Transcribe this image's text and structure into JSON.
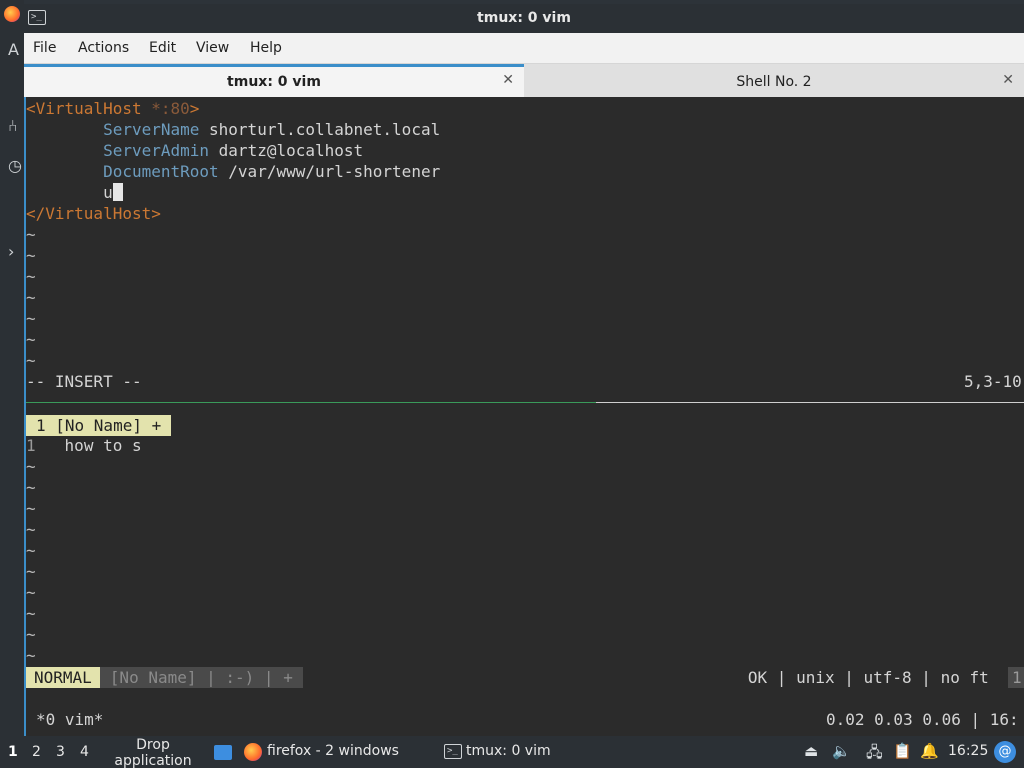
{
  "desktop": {
    "left_glyphs": [
      "A",
      "⑃",
      "◷",
      "›"
    ]
  },
  "window": {
    "title": "tmux: 0 vim",
    "menu": [
      "File",
      "Actions",
      "Edit",
      "View",
      "Help"
    ],
    "tabs": [
      {
        "label": "tmux: 0 vim",
        "active": true
      },
      {
        "label": "Shell No. 2",
        "active": false
      }
    ]
  },
  "vim_top": {
    "lines": [
      {
        "parts": [
          "<VirtualHost",
          " *:80",
          ">"
        ]
      },
      {
        "key": "ServerName",
        "value": " shorturl.collabnet.local"
      },
      {
        "key": "ServerAdmin",
        "value": " dartz@localhost"
      },
      {
        "key": "DocumentRoot",
        "value": " /var/www/url-shortener"
      },
      {
        "typed": "u"
      },
      {
        "close_tag": "</VirtualHost>"
      }
    ],
    "tilde": "~",
    "tilde_count": 7,
    "mode": "-- INSERT --",
    "position": "5,3-10"
  },
  "vim_bottom": {
    "buffer_tab": "1 [No Name] +",
    "line_number": "1",
    "line_text": "how to s",
    "tilde": "~",
    "tilde_count": 10,
    "airline_mode": "NORMAL",
    "airline_file": "[No Name] | :-) | +",
    "airline_right": "OK | unix | utf-8 | no ft",
    "airline_edge": "1"
  },
  "tmux_status": {
    "left": "*0 vim*",
    "right": "0.02 0.03 0.06 | 16:"
  },
  "taskbar": {
    "workspaces": [
      "1",
      "2",
      "3",
      "4"
    ],
    "drop_text": "Drop application icons here",
    "tasks": [
      "firefox - 2 windows",
      "tmux: 0 vim"
    ],
    "clock": "16:25",
    "tray_icons": [
      "upload-icon",
      "volume-icon",
      "network-icon",
      "clipboard-icon",
      "notification-icon"
    ]
  }
}
